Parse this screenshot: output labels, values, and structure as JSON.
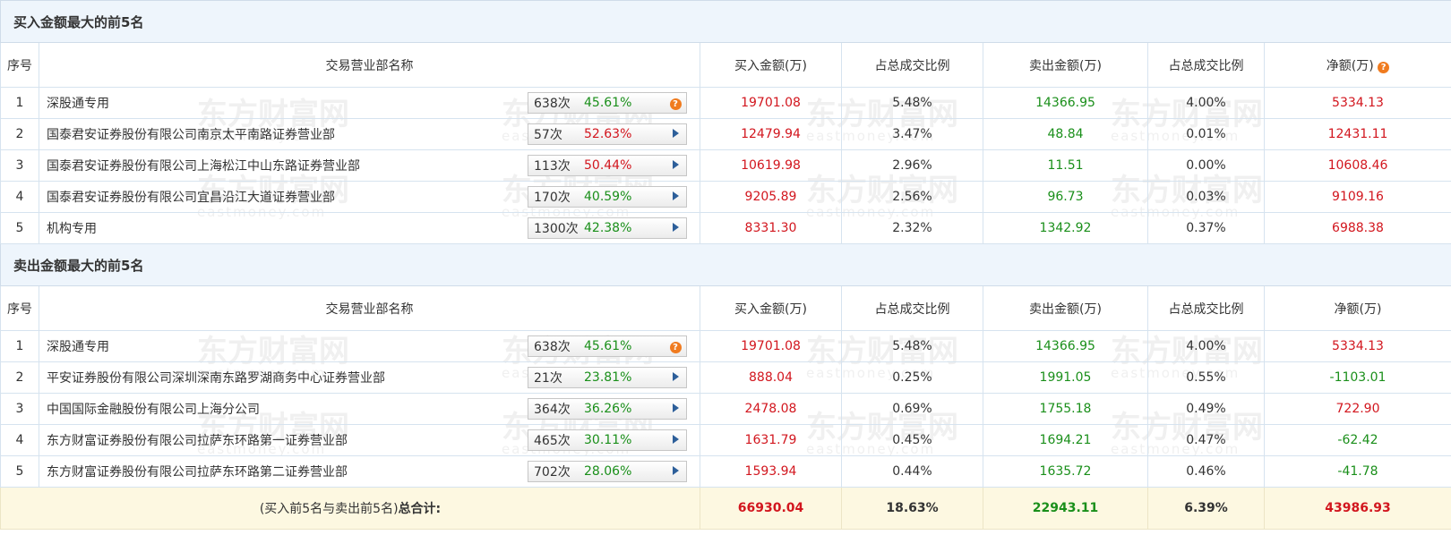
{
  "watermark": {
    "cn": "东方财富网",
    "en": "eastmoney.com"
  },
  "buy_section": {
    "title": "买入金额最大的前5名",
    "headers": [
      "序号",
      "交易营业部名称",
      "买入金额(万)",
      "占总成交比例",
      "卖出金额(万)",
      "占总成交比例",
      "净额(万)"
    ],
    "rows": [
      {
        "idx": "1",
        "name": "深股通专用",
        "count": "638次",
        "pct": "45.61%",
        "pct_color": "green",
        "icon": "question-icon",
        "buy": "19701.08",
        "buy_ratio": "5.48%",
        "sell": "14366.95",
        "sell_ratio": "4.00%",
        "net": "5334.13",
        "net_color": "red"
      },
      {
        "idx": "2",
        "name": "国泰君安证券股份有限公司南京太平南路证券营业部",
        "count": "57次",
        "pct": "52.63%",
        "pct_color": "red",
        "icon": "arrow-icon",
        "buy": "12479.94",
        "buy_ratio": "3.47%",
        "sell": "48.84",
        "sell_ratio": "0.01%",
        "net": "12431.11",
        "net_color": "red"
      },
      {
        "idx": "3",
        "name": "国泰君安证券股份有限公司上海松江中山东路证券营业部",
        "count": "113次",
        "pct": "50.44%",
        "pct_color": "red",
        "icon": "arrow-icon",
        "buy": "10619.98",
        "buy_ratio": "2.96%",
        "sell": "11.51",
        "sell_ratio": "0.00%",
        "net": "10608.46",
        "net_color": "red"
      },
      {
        "idx": "4",
        "name": "国泰君安证券股份有限公司宜昌沿江大道证券营业部",
        "count": "170次",
        "pct": "40.59%",
        "pct_color": "green",
        "icon": "arrow-icon",
        "buy": "9205.89",
        "buy_ratio": "2.56%",
        "sell": "96.73",
        "sell_ratio": "0.03%",
        "net": "9109.16",
        "net_color": "red"
      },
      {
        "idx": "5",
        "name": "机构专用",
        "count": "1300次",
        "pct": "42.38%",
        "pct_color": "green",
        "icon": "arrow-icon",
        "buy": "8331.30",
        "buy_ratio": "2.32%",
        "sell": "1342.92",
        "sell_ratio": "0.37%",
        "net": "6988.38",
        "net_color": "red"
      }
    ]
  },
  "sell_section": {
    "title": "卖出金额最大的前5名",
    "headers": [
      "序号",
      "交易营业部名称",
      "买入金额(万)",
      "占总成交比例",
      "卖出金额(万)",
      "占总成交比例",
      "净额(万)"
    ],
    "rows": [
      {
        "idx": "1",
        "name": "深股通专用",
        "count": "638次",
        "pct": "45.61%",
        "pct_color": "green",
        "icon": "question-icon",
        "buy": "19701.08",
        "buy_ratio": "5.48%",
        "sell": "14366.95",
        "sell_ratio": "4.00%",
        "net": "5334.13",
        "net_color": "red"
      },
      {
        "idx": "2",
        "name": "平安证券股份有限公司深圳深南东路罗湖商务中心证券营业部",
        "count": "21次",
        "pct": "23.81%",
        "pct_color": "green",
        "icon": "arrow-icon",
        "buy": "888.04",
        "buy_ratio": "0.25%",
        "sell": "1991.05",
        "sell_ratio": "0.55%",
        "net": "-1103.01",
        "net_color": "green"
      },
      {
        "idx": "3",
        "name": "中国国际金融股份有限公司上海分公司",
        "count": "364次",
        "pct": "36.26%",
        "pct_color": "green",
        "icon": "arrow-icon",
        "buy": "2478.08",
        "buy_ratio": "0.69%",
        "sell": "1755.18",
        "sell_ratio": "0.49%",
        "net": "722.90",
        "net_color": "red"
      },
      {
        "idx": "4",
        "name": "东方财富证券股份有限公司拉萨东环路第一证券营业部",
        "count": "465次",
        "pct": "30.11%",
        "pct_color": "green",
        "icon": "arrow-icon",
        "buy": "1631.79",
        "buy_ratio": "0.45%",
        "sell": "1694.21",
        "sell_ratio": "0.47%",
        "net": "-62.42",
        "net_color": "green"
      },
      {
        "idx": "5",
        "name": "东方财富证券股份有限公司拉萨东环路第二证券营业部",
        "count": "702次",
        "pct": "28.06%",
        "pct_color": "green",
        "icon": "arrow-icon",
        "buy": "1593.94",
        "buy_ratio": "0.44%",
        "sell": "1635.72",
        "sell_ratio": "0.46%",
        "net": "-41.78",
        "net_color": "green"
      }
    ]
  },
  "total": {
    "label_prefix": "(买入前5名与卖出前5名)",
    "label_bold": "总合计:",
    "buy": "66930.04",
    "buy_ratio": "18.63%",
    "sell": "22943.11",
    "sell_ratio": "6.39%",
    "net": "43986.93"
  },
  "colors": {
    "red": "#d2161e",
    "green": "#1a8f1a",
    "header_bg": "#eef5fc",
    "total_bg": "#fdf8e1",
    "icon_orange": "#f07b1f",
    "arrow_blue": "#2d5f9a"
  }
}
